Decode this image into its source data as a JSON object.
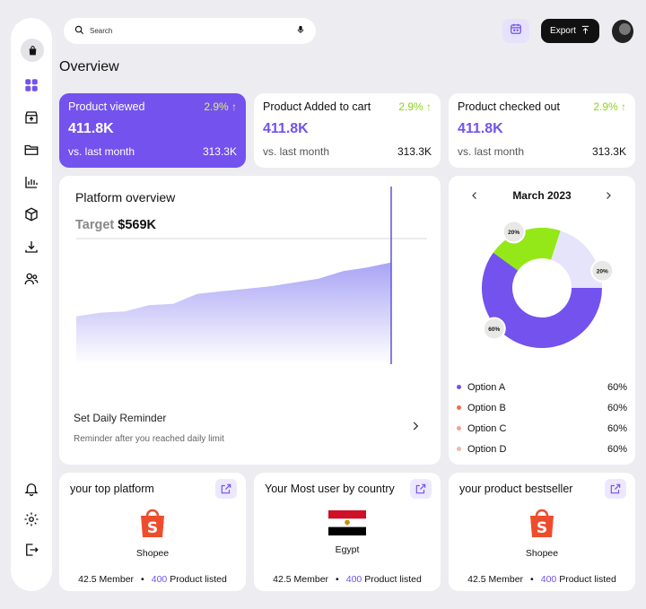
{
  "search": {
    "placeholder": "Search"
  },
  "header": {
    "export_label": "Export"
  },
  "page": {
    "title": "Overview"
  },
  "colors": {
    "accent": "#7352ee",
    "positive": "#8fd21a",
    "option_green": "#94e817",
    "option_light": "#e6e4fb"
  },
  "sidebar": {
    "icons": [
      "bag-icon",
      "dashboard-icon",
      "store-icon",
      "folder-icon",
      "bar-chart-icon",
      "box-icon",
      "download-icon",
      "users-icon",
      "bell-icon",
      "settings-icon",
      "logout-icon"
    ]
  },
  "stats": [
    {
      "title": "Product viewed",
      "change": "2.9% ↑",
      "value": "411.8K",
      "compare_label": "vs. last month",
      "compare_value": "313.3K"
    },
    {
      "title": "Product Added to cart",
      "change": "2.9% ↑",
      "value": "411.8K",
      "compare_label": "vs. last month",
      "compare_value": "313.3K"
    },
    {
      "title": "Product checked out",
      "change": "2.9% ↑",
      "value": "411.8K",
      "compare_label": "vs. last month",
      "compare_value": "313.3K"
    }
  ],
  "platform": {
    "title": "Platform overview",
    "target_label": "Target",
    "target_value": "$569K",
    "reminder_title": "Set Daily Reminder",
    "reminder_sub": "Reminder after you reached daily limit"
  },
  "chart_data": [
    {
      "type": "area",
      "title": "Platform overview",
      "x": [
        0,
        1,
        2,
        3,
        4,
        5,
        6,
        7,
        8,
        9,
        10,
        11,
        12,
        13
      ],
      "series": [
        {
          "values": [
            38,
            41,
            42,
            47,
            48,
            56,
            58,
            60,
            62,
            65,
            68,
            74,
            77,
            81
          ]
        }
      ],
      "ylim": [
        0,
        100
      ],
      "target_line": 100
    },
    {
      "type": "pie",
      "title": "March 2023",
      "donut": true,
      "categories": [
        "Purple segment",
        "Green segment",
        "Light segment"
      ],
      "values": [
        60,
        20,
        20
      ],
      "data_labels": [
        "60%",
        "20%",
        "20%"
      ]
    }
  ],
  "donut": {
    "month": "March 2023",
    "segments": [
      {
        "label": "60%",
        "value": 60,
        "color": "#7352ee"
      },
      {
        "label": "20%",
        "value": 20,
        "color": "#94e817"
      },
      {
        "label": "20%",
        "value": 20,
        "color": "#e6e4fb"
      }
    ],
    "legend": [
      {
        "name": "Option A",
        "value": "60%",
        "color": "#7352ee"
      },
      {
        "name": "Option B",
        "value": "60%",
        "color": "#f06d4f"
      },
      {
        "name": "Option C",
        "value": "60%",
        "color": "#f5a28a"
      },
      {
        "name": "Option D",
        "value": "60%",
        "color": "#f2b9a5"
      }
    ]
  },
  "bottom_cards": [
    {
      "title": "your top platform",
      "item": "Shopee",
      "members": "42.5 Member",
      "products_count": "400",
      "products_label": "Product listed"
    },
    {
      "title": "Your Most user by country",
      "item": "Egypt",
      "members": "42.5 Member",
      "products_count": "400",
      "products_label": "Product listed"
    },
    {
      "title": "your product bestseller",
      "item": "Shopee",
      "members": "42.5 Member",
      "products_count": "400",
      "products_label": "Product listed"
    }
  ]
}
